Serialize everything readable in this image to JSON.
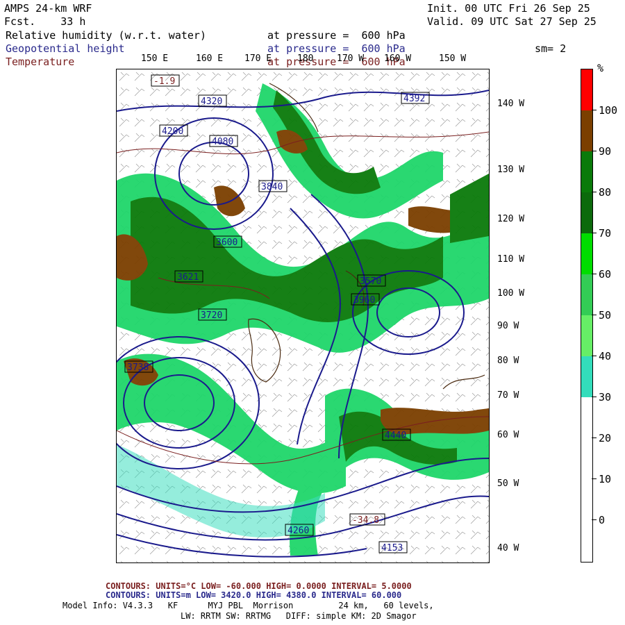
{
  "header": {
    "model_title": "AMPS 24-km WRF",
    "forecast": "Fcst.    33 h",
    "init": "Init. 00 UTC Fri 26 Sep 25",
    "valid": "Valid. 09 UTC Sat 27 Sep 25",
    "field1": "Relative humidity (w.r.t. water)",
    "field1_level": "at pressure =  600 hPa",
    "field2": "Geopotential height",
    "field2_level": "at pressure =  600 hPa",
    "field3": "Temperature",
    "field3_level": "at pressure =  600 hPa",
    "smoothing": "sm= 2"
  },
  "lon_labels": [
    "150 E",
    "160 E",
    "170 E",
    "180",
    "170 W",
    "160 W",
    "150 W"
  ],
  "lat_labels": [
    "140 W",
    "130 W",
    "120 W",
    "110 W",
    "100 W",
    "90 W",
    "80 W",
    "70 W",
    "60 W",
    "50 W",
    "40 W"
  ],
  "colorbar": {
    "unit": "%",
    "labels": [
      "100",
      "90",
      "80",
      "70",
      "60",
      "50",
      "40",
      "30",
      "20",
      "10",
      "0"
    ],
    "colors": {
      "c90_100": "#ff0000",
      "c80_90": "#7b3f00",
      "c70_80": "#0a7a0a",
      "c60_70": "#0c6a0c",
      "c50_60": "#00dd00",
      "c40_50": "#33cc55",
      "c30_40": "#66ee66",
      "c20_30": "#33ddbb",
      "c0_20": "#ffffff"
    }
  },
  "contour_labels": {
    "height": [
      "4320",
      "4200",
      "4080",
      "3960",
      "3840",
      "3720",
      "3600",
      "4392",
      "4153",
      "3738",
      "3621",
      "4440",
      "4260",
      "3570"
    ],
    "temperature": [
      "-1.9",
      "-34.8"
    ]
  },
  "footer": {
    "temp_contours": "CONTOURS:  UNITS=°C  LOW= -60.000      HIGH=  0.0000      INTERVAL=   5.0000",
    "height_contours": "CONTOURS:  UNITS=m  LOW=  3420.0      HIGH=  4380.0      INTERVAL=   60.000",
    "model_info": "Model Info: V4.3.3   KF      MYJ PBL  Morrison         24 km,   60 levels,",
    "physics": "LW: RRTM SW: RRTMG   DIFF: simple KM: 2D Smagor"
  }
}
